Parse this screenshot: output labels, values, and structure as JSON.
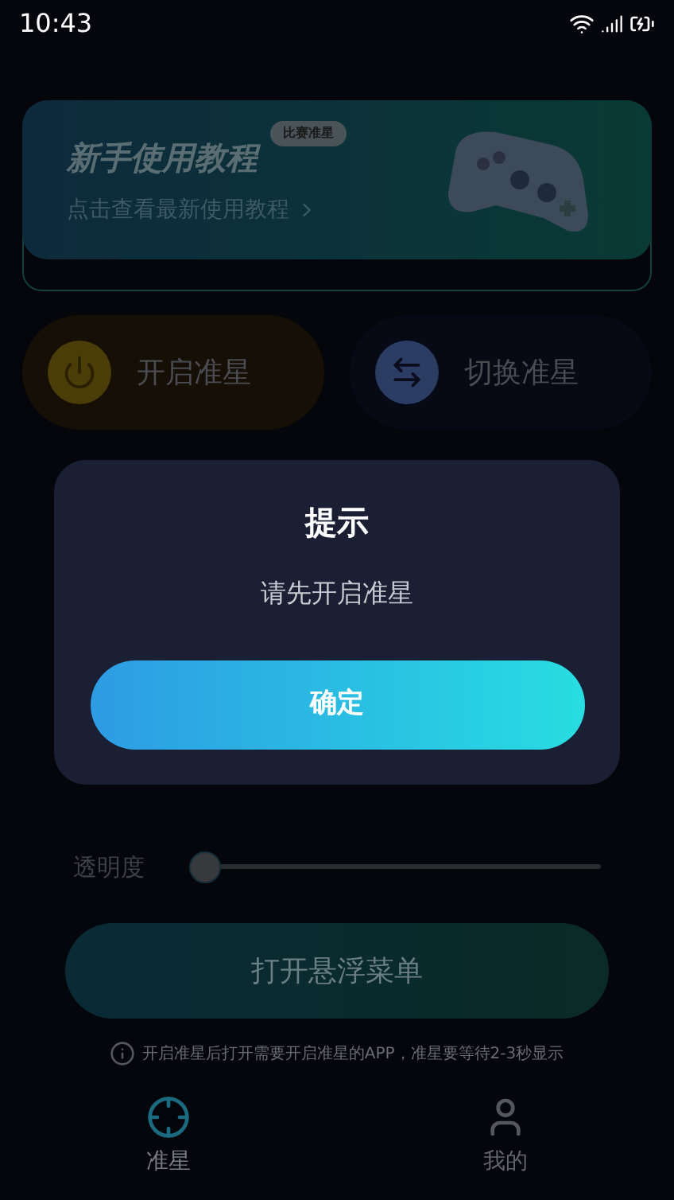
{
  "status_bar": {
    "time": "10:43"
  },
  "banner": {
    "title": "新手使用教程",
    "badge": "比赛准星",
    "subtitle": "点击查看最新使用教程"
  },
  "actions": [
    {
      "kind": "power",
      "label": "开启准星"
    },
    {
      "kind": "switch",
      "label": "切换准星"
    }
  ],
  "opacity": {
    "label": "透明度",
    "level": 0
  },
  "menu_button": "打开悬浮菜单",
  "note": "开启准星后打开需要开启准星的APP，准星要等待2-3秒显示",
  "bottom_nav": [
    {
      "kind": "crosshair",
      "label": "准星",
      "selected": true
    },
    {
      "kind": "user",
      "label": "我的",
      "selected": false
    }
  ],
  "dialog": {
    "title": "提示",
    "message": "请先开启准星",
    "button": "确定"
  }
}
